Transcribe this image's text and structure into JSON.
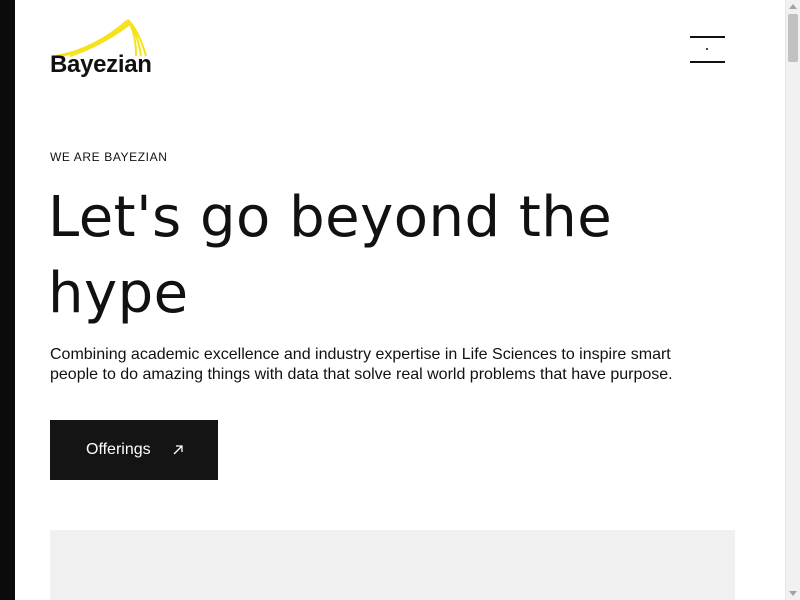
{
  "brand": {
    "name": "Bayezian",
    "logo_color": "#F5E21B",
    "logo_icon": "swoosh-arcs"
  },
  "header": {
    "menu_icon": "hamburger-menu-icon"
  },
  "hero": {
    "eyebrow": "WE ARE BAYEZIAN",
    "headline_line1": "Let's go beyond the",
    "headline_line2": "hype",
    "lede_line1": "Combining academic excellence and industry expertise in Life Sciences to inspire smart",
    "lede_line2": "people to do amazing things with data that solve real world problems that have purpose.",
    "cta_label": "Offerings",
    "cta_icon": "arrow-up-right-icon"
  },
  "colors": {
    "text": "#111111",
    "cta_background": "#141414",
    "cta_text": "#FFFFFF",
    "placeholder": "#F0F0F0",
    "frame": "#0B0B0B"
  }
}
